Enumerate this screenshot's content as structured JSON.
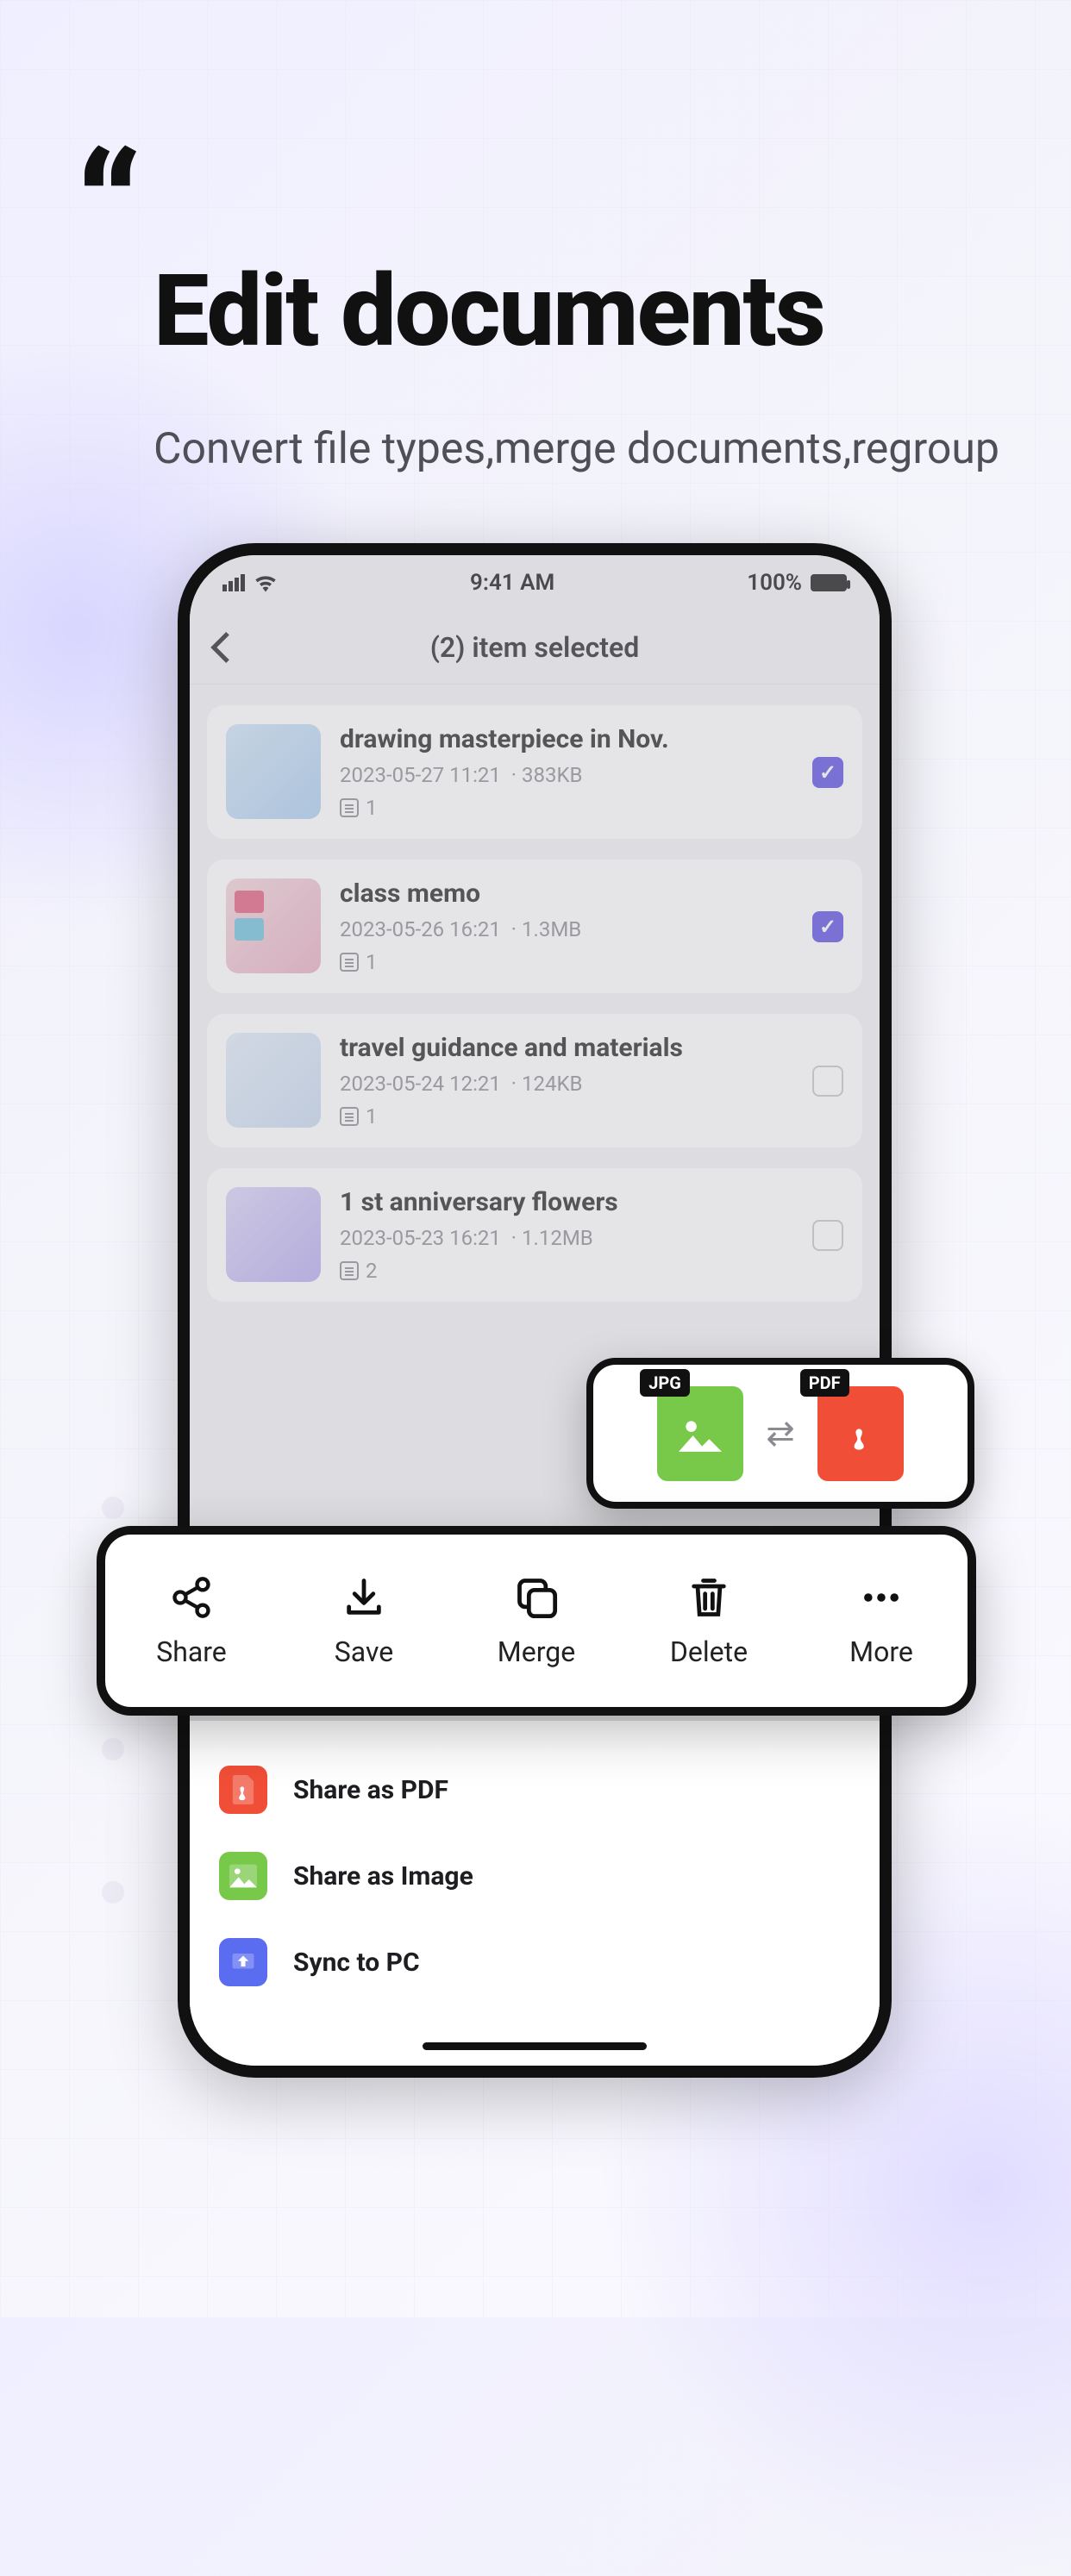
{
  "hero": {
    "title": "Edit documents",
    "subtitle": "Convert file types,merge documents,regroup"
  },
  "statusbar": {
    "time": "9:41 AM",
    "battery": "100%"
  },
  "nav": {
    "title": "(2) item selected"
  },
  "documents": [
    {
      "title": "drawing masterpiece in Nov.",
      "date": "2023-05-27 11:21",
      "size": "383KB",
      "pages": "1",
      "checked": true
    },
    {
      "title": "class memo",
      "date": "2023-05-26 16:21",
      "size": "1.3MB",
      "pages": "1",
      "checked": true
    },
    {
      "title": "travel guidance and materials",
      "date": "2023-05-24 12:21",
      "size": "124KB",
      "pages": "1",
      "checked": false
    },
    {
      "title": "1 st anniversary flowers",
      "date": "2023-05-23 16:21",
      "size": "1.12MB",
      "pages": "2",
      "checked": false
    }
  ],
  "toolbar": {
    "share": "Share",
    "save": "Save",
    "merge": "Merge",
    "delete": "Delete",
    "more": "More"
  },
  "sheet": {
    "share_pdf": "Share as PDF",
    "share_image": "Share as Image",
    "sync_pc": "Sync to PC"
  },
  "convert": {
    "from": "JPG",
    "to": "PDF"
  }
}
